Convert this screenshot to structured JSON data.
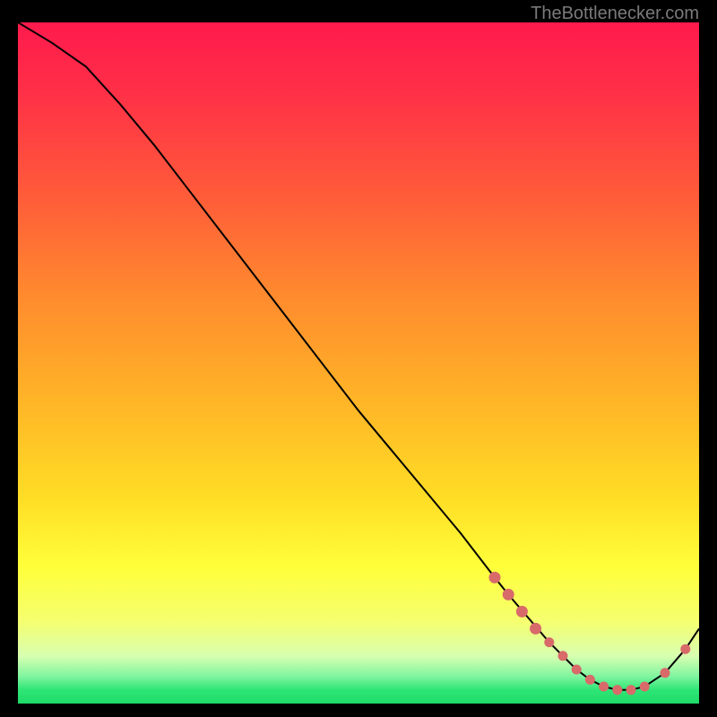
{
  "attribution": "TheBottlenecker.com",
  "chart_data": {
    "type": "line",
    "title": "",
    "xlabel": "",
    "ylabel": "",
    "xlim": [
      0,
      100
    ],
    "ylim": [
      0,
      100
    ],
    "grid": false,
    "x": [
      0,
      5,
      10,
      15,
      20,
      25,
      30,
      35,
      40,
      45,
      50,
      55,
      60,
      65,
      70,
      72,
      75,
      78,
      80,
      82,
      84,
      86,
      88,
      90,
      92,
      95,
      98,
      100
    ],
    "y": [
      100,
      97,
      93.5,
      88,
      82,
      75.5,
      69,
      62.5,
      56,
      49.5,
      43,
      37,
      31,
      25,
      18.5,
      16,
      12.5,
      9,
      7,
      5,
      3.5,
      2.5,
      2,
      2,
      2.5,
      4.5,
      8,
      11
    ],
    "markers": {
      "x": [
        70,
        72,
        74,
        76,
        78,
        80,
        82,
        84,
        86,
        88,
        90,
        92,
        95,
        98
      ],
      "y": [
        18.5,
        16,
        13.5,
        11,
        9,
        7,
        5,
        3.5,
        2.5,
        2,
        2,
        2.5,
        4.5,
        8
      ],
      "color": "#d86a6a"
    },
    "gradient_stops": [
      {
        "offset": 0.0,
        "color": "#ff1a4d"
      },
      {
        "offset": 0.1,
        "color": "#ff2f47"
      },
      {
        "offset": 0.25,
        "color": "#ff5a3a"
      },
      {
        "offset": 0.4,
        "color": "#ff8a2e"
      },
      {
        "offset": 0.55,
        "color": "#ffb327"
      },
      {
        "offset": 0.7,
        "color": "#ffde25"
      },
      {
        "offset": 0.8,
        "color": "#ffff3a"
      },
      {
        "offset": 0.88,
        "color": "#f5ff70"
      },
      {
        "offset": 0.93,
        "color": "#d8ffb0"
      },
      {
        "offset": 0.96,
        "color": "#80f5a0"
      },
      {
        "offset": 0.98,
        "color": "#2ee675"
      },
      {
        "offset": 1.0,
        "color": "#1fd968"
      }
    ]
  }
}
